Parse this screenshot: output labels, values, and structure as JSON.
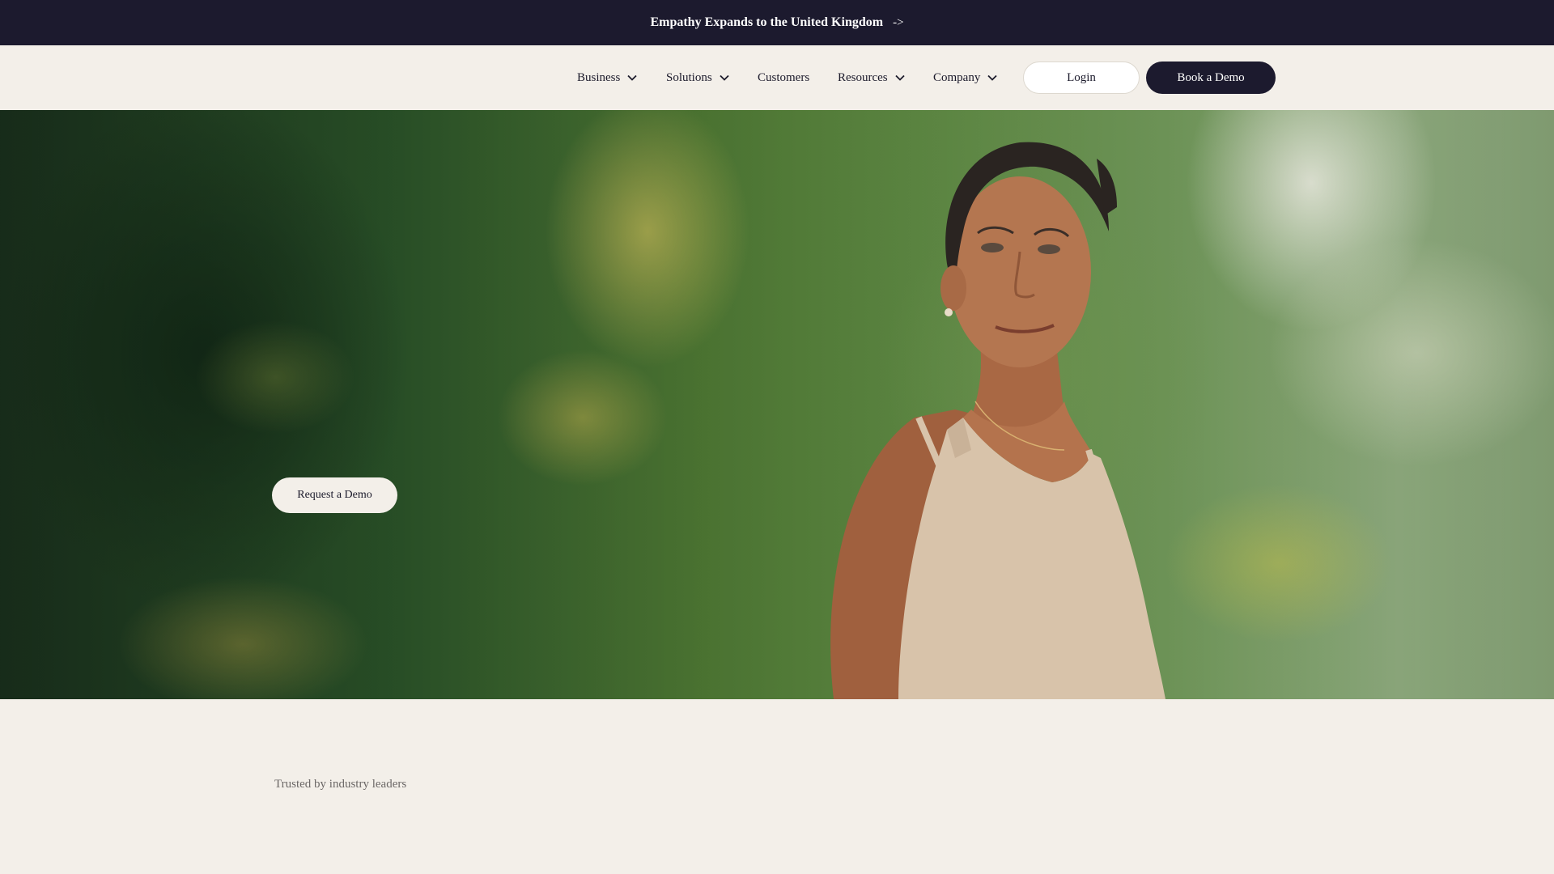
{
  "announcement": {
    "text": "Empathy Expands to the United Kingdom",
    "arrow": "->"
  },
  "nav": {
    "items": [
      {
        "label": "Business",
        "has_dropdown": true
      },
      {
        "label": "Solutions",
        "has_dropdown": true
      },
      {
        "label": "Customers",
        "has_dropdown": false
      },
      {
        "label": "Resources",
        "has_dropdown": true
      },
      {
        "label": "Company",
        "has_dropdown": true
      }
    ],
    "login_label": "Login",
    "book_demo_label": "Book a Demo"
  },
  "hero": {
    "cta_label": "Request a Demo",
    "image_description_icon": "portrait-photo"
  },
  "trusted": {
    "text": "Trusted by industry leaders"
  },
  "colors": {
    "dark": "#1c1a2e",
    "background": "#f3efe9",
    "muted_text": "#6b6766"
  }
}
